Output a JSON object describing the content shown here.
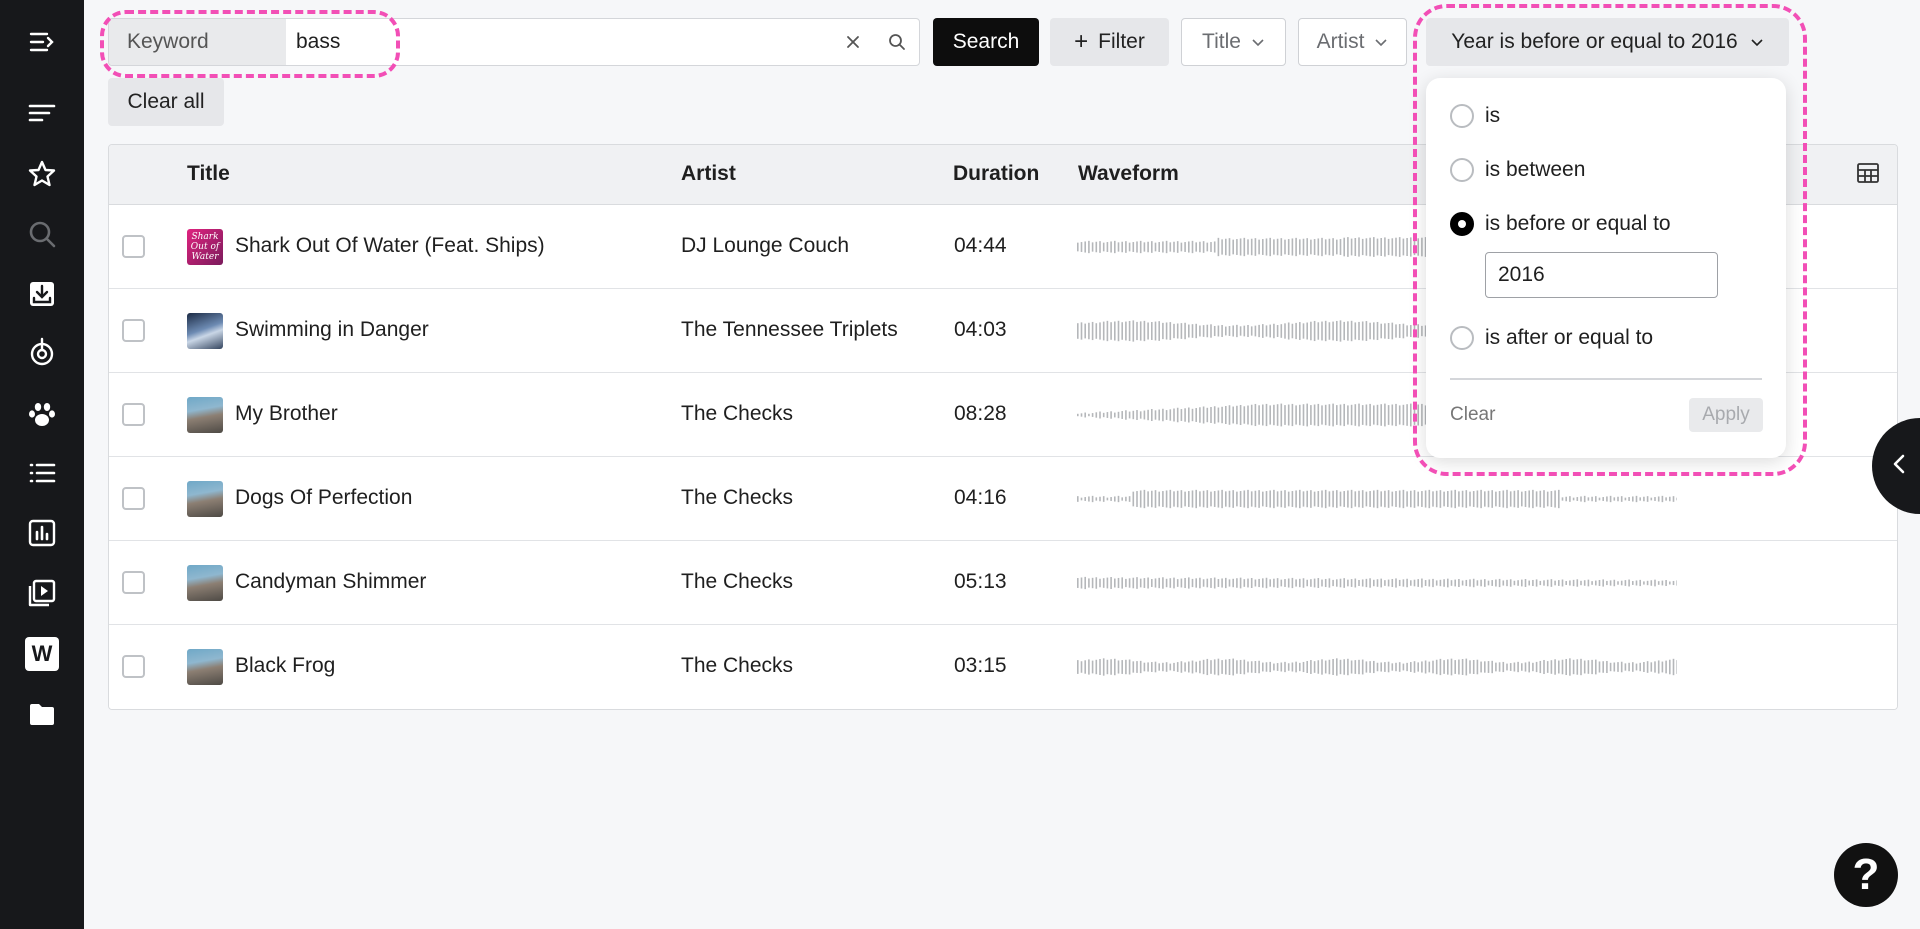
{
  "sidebar": {
    "items": [
      {
        "icon": "collapse-menu-icon"
      },
      {
        "icon": "sort-lines-icon"
      },
      {
        "icon": "star-icon"
      },
      {
        "icon": "search-icon"
      },
      {
        "icon": "download-tray-icon"
      },
      {
        "icon": "radio-signal-icon"
      },
      {
        "icon": "paw-icon"
      },
      {
        "icon": "list-icon"
      },
      {
        "icon": "bar-chart-icon"
      },
      {
        "icon": "playlist-play-icon"
      },
      {
        "icon": "w-logo-icon",
        "label": "W"
      },
      {
        "icon": "folder-icon"
      }
    ]
  },
  "filters": {
    "keyword_label": "Keyword",
    "keyword_value": "bass",
    "search_label": "Search",
    "filter_label": "Filter",
    "title_label": "Title",
    "artist_label": "Artist",
    "year_label": "Year is before or equal to 2016",
    "clear_all_label": "Clear all"
  },
  "table": {
    "columns": [
      "Title",
      "Artist",
      "Duration",
      "Waveform"
    ],
    "rows": [
      {
        "title": "Shark Out Of Water (Feat. Ships)",
        "artist": "DJ Lounge Couch",
        "duration": "04:44",
        "thumb_text": "Shark Out of Water"
      },
      {
        "title": "Swimming in Danger",
        "artist": "The Tennessee Triplets",
        "duration": "04:03"
      },
      {
        "title": "My Brother",
        "artist": "The Checks",
        "duration": "08:28"
      },
      {
        "title": "Dogs Of Perfection",
        "artist": "The Checks",
        "duration": "04:16"
      },
      {
        "title": "Candyman Shimmer",
        "artist": "The Checks",
        "duration": "05:13"
      },
      {
        "title": "Black Frog",
        "artist": "The Checks",
        "duration": "03:15"
      }
    ]
  },
  "year_filter": {
    "options": [
      "is",
      "is between",
      "is before or equal to",
      "is after or equal to"
    ],
    "selected": "is before or equal to",
    "value": "2016",
    "clear_label": "Clear",
    "apply_label": "Apply"
  },
  "help_label": "?",
  "colors": {
    "sidebar_bg": "#17181b",
    "highlight": "#f24fb6",
    "page_bg": "#f6f7f9"
  }
}
